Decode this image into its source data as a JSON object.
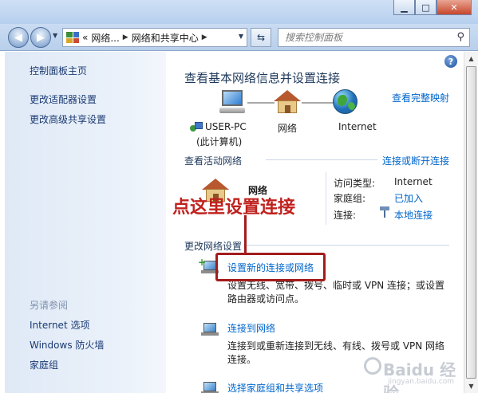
{
  "window": {
    "minimize": "▁",
    "maximize": "□",
    "close": "✕"
  },
  "address_bar": {
    "back_glyph": "◀",
    "forward_glyph": "▶",
    "crumb_prefix": "«",
    "crumbs": [
      "网络...",
      "网络和共享中心"
    ],
    "search_placeholder": "搜索控制面板",
    "search_icon": "search-icon",
    "refresh_icon": "refresh-icon"
  },
  "sidebar": {
    "links": [
      "控制面板主页",
      "更改适配器设置",
      "更改高级共享设置"
    ],
    "see_also_heading": "另请参阅",
    "see_also": [
      "Internet 选项",
      "Windows 防火墙",
      "家庭组"
    ]
  },
  "main": {
    "title": "查看基本网络信息并设置连接",
    "full_map_link": "查看完整映射",
    "map": {
      "computer_name": "USER-PC",
      "computer_sub": "(此计算机)",
      "network_label": "网络",
      "internet_label": "Internet"
    },
    "active_networks": {
      "heading": "查看活动网络",
      "toggle_link": "连接或断开连接",
      "network_name": "网络",
      "rows": [
        {
          "label": "访问类型:",
          "value": "Internet",
          "is_link": false
        },
        {
          "label": "家庭组:",
          "value": "已加入",
          "is_link": true
        },
        {
          "label": "连接:",
          "value": "本地连接",
          "is_link": true
        }
      ]
    },
    "change_settings": {
      "heading": "更改网络设置",
      "tasks": [
        {
          "title": "设置新的连接或网络",
          "desc_line1": "设置无线、宽带、拨号、临时或 VPN 连接；或设置",
          "desc_line2": "路由器或访问点。"
        },
        {
          "title": "连接到网络",
          "desc_line1": "连接到或重新连接到无线、有线、拨号或 VPN 网络",
          "desc_line2": "连接。"
        },
        {
          "title": "选择家庭组和共享选项"
        }
      ]
    }
  },
  "annotation": {
    "callout_text": "点这里设置连接"
  },
  "watermark": {
    "text": "Baidu 经验",
    "url": "jingyan.baidu.com"
  },
  "colors": {
    "link": "#0066cc",
    "callout": "#c0211e",
    "title": "#1e395b"
  }
}
